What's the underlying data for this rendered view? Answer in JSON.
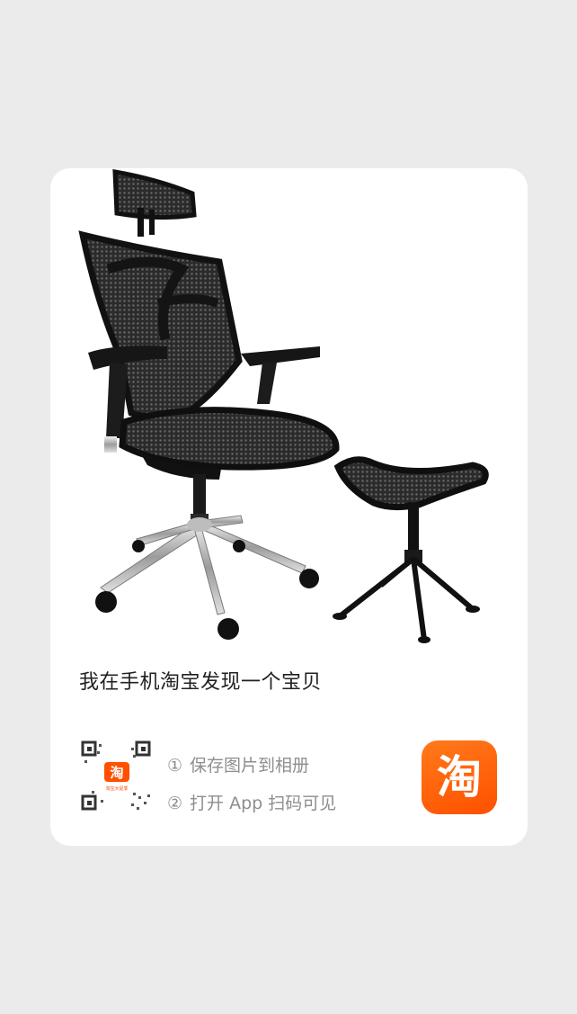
{
  "product": {
    "image_icon": "office-chair-with-footrest-photo"
  },
  "share": {
    "title": "我在手机淘宝发现一个宝贝"
  },
  "instructions": {
    "step1_num": "①",
    "step1_text": "保存图片到相册",
    "step2_num": "②",
    "step2_text": "打开 App 扫码可见"
  },
  "qr": {
    "badge_char": "淘",
    "badge_caption": "淘宝大促季"
  },
  "app": {
    "logo_char": "淘",
    "icon": "taobao-logo-icon"
  },
  "colors": {
    "brand": "#ff5000",
    "background": "#ebebeb",
    "card": "#ffffff",
    "title_text": "#222222",
    "hint_text": "#8e8e8e"
  }
}
